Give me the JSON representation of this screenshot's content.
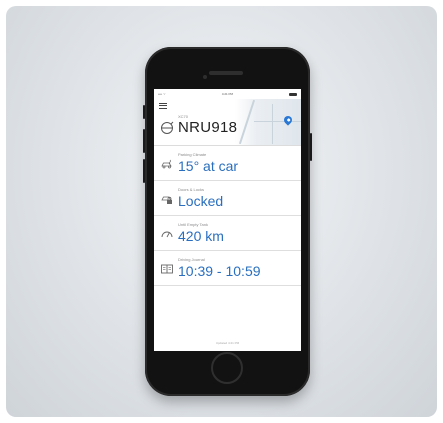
{
  "status_bar": {
    "carrier": "•••• ⌔",
    "time": "4:21 PM"
  },
  "vehicle": {
    "label": "XC70",
    "registration": "NRU918"
  },
  "rows": [
    {
      "icon": "car-climate-icon",
      "label": "Parking Climate",
      "value": "15° at car"
    },
    {
      "icon": "car-lock-icon",
      "label": "Doors & Locks",
      "value": "Locked"
    },
    {
      "icon": "gauge-icon",
      "label": "Until Empty Tank",
      "value": "420 km"
    },
    {
      "icon": "journal-icon",
      "label": "Driving Journal",
      "value": "10:39 - 10:59"
    }
  ],
  "footer_text": "Updated 4:21 PM",
  "colors": {
    "accent": "#2a6fbf",
    "pin": "#2a78d6",
    "phone": "#121212"
  }
}
